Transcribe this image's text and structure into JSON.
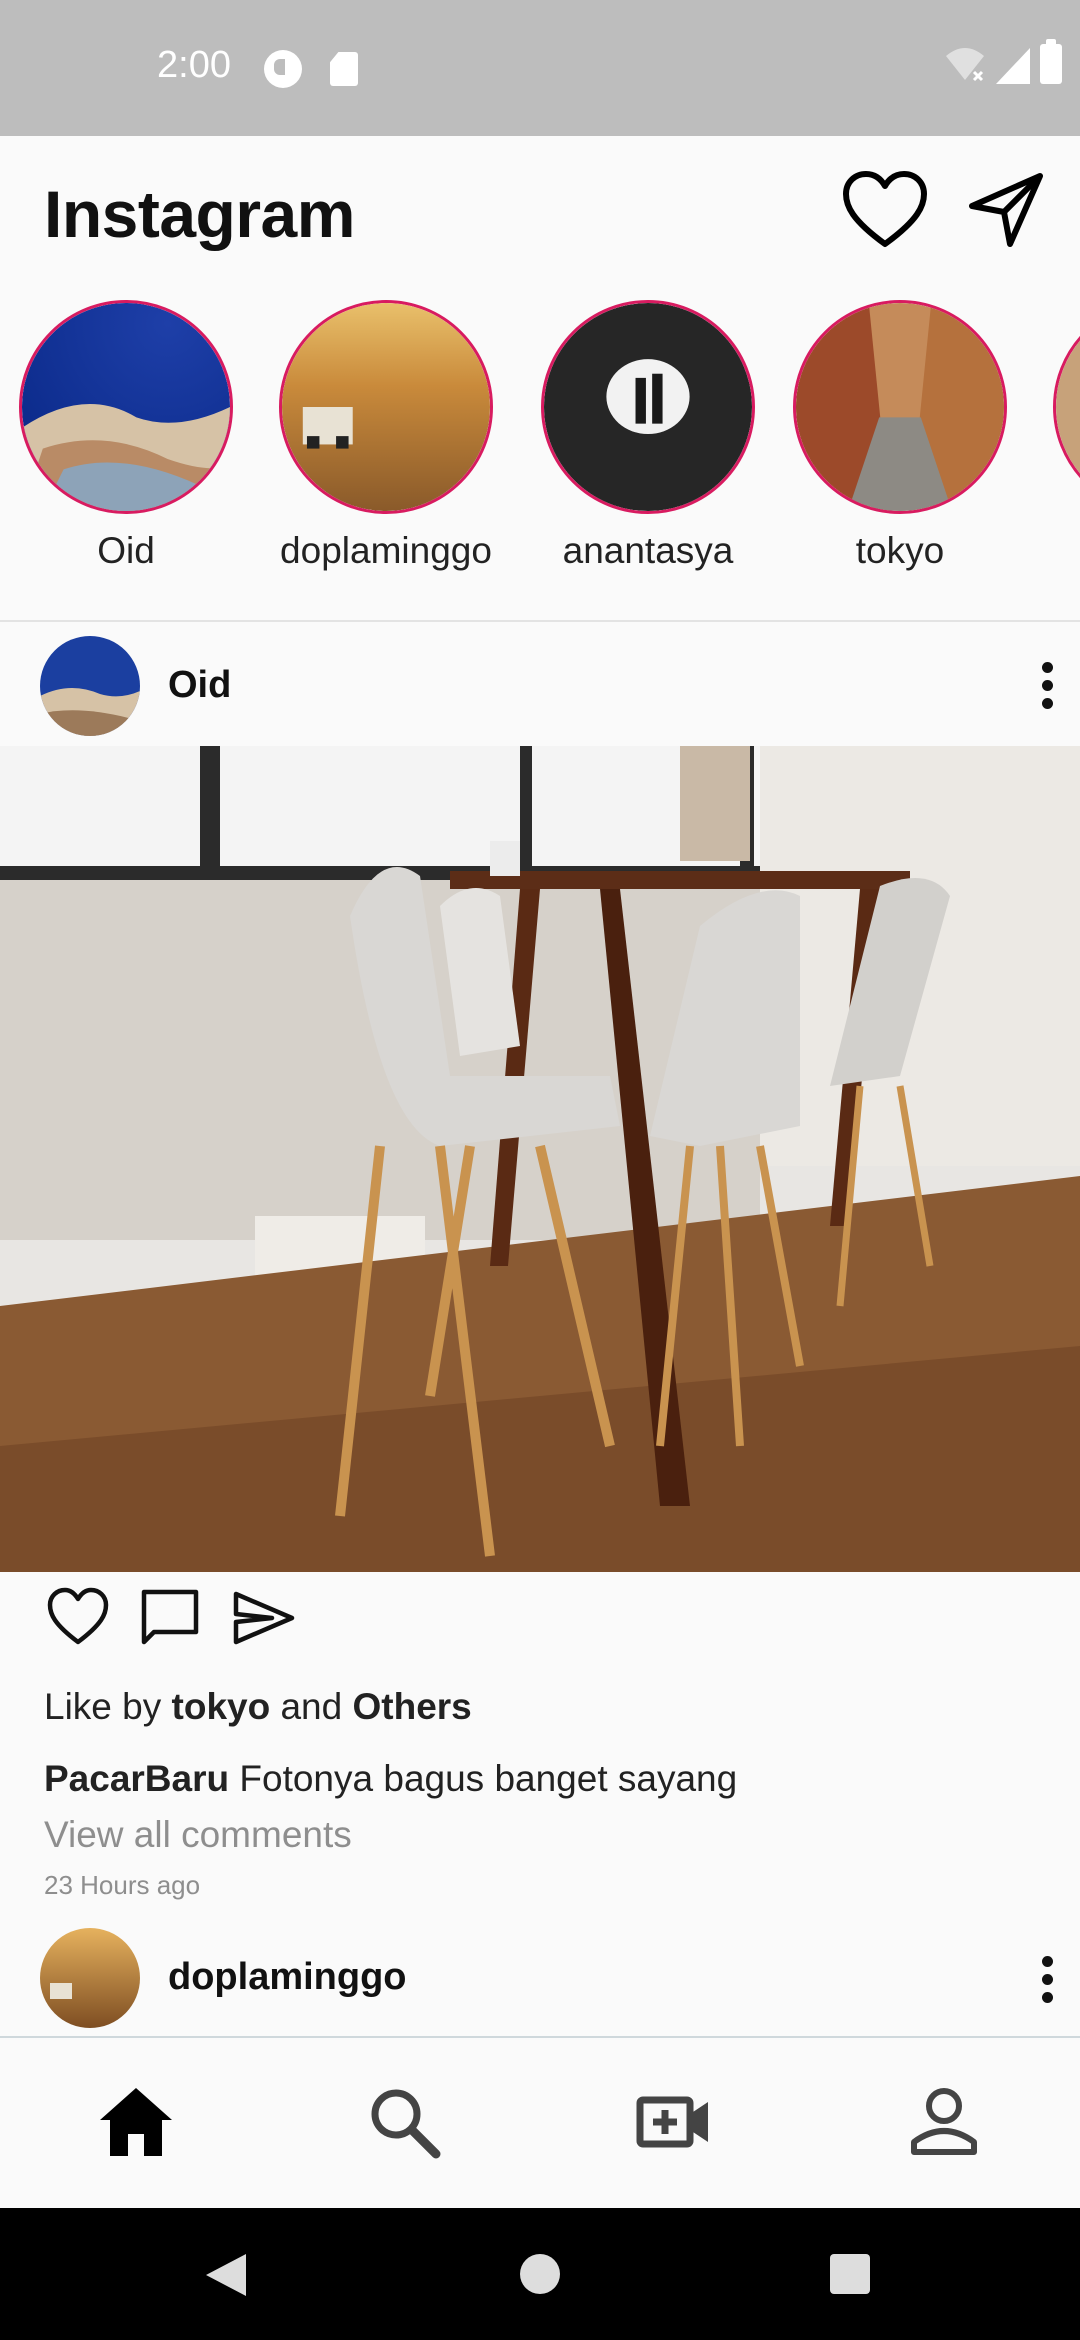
{
  "status_bar": {
    "time": "2:00",
    "icons": [
      "notification-icon",
      "sd-card-icon",
      "wifi-off-icon",
      "signal-icon",
      "battery-icon"
    ]
  },
  "header": {
    "title": "Instagram",
    "icons": [
      "heart-icon",
      "send-icon"
    ]
  },
  "stories": [
    {
      "label": "Oid"
    },
    {
      "label": "doplaminggo"
    },
    {
      "label": "anantasya"
    },
    {
      "label": "tokyo"
    }
  ],
  "post": {
    "username": "Oid",
    "liked_by_prefix": "Like by",
    "liked_by_user": "tokyo",
    "liked_by_and": "and",
    "liked_by_others": "Others",
    "caption_user": "PacarBaru",
    "caption_text": "Fotonya bagus banget sayang",
    "view_comments": "View all comments",
    "timestamp": "23 Hours ago"
  },
  "next_post": {
    "username": "doplaminggo"
  },
  "bottom_nav": {
    "items": [
      "home-icon",
      "search-icon",
      "add-video-icon",
      "profile-icon"
    ],
    "active": "home-icon"
  },
  "colors": {
    "story_ring": "#d81b60",
    "status_bar": "#bdbdbd",
    "background": "#fafafa"
  }
}
